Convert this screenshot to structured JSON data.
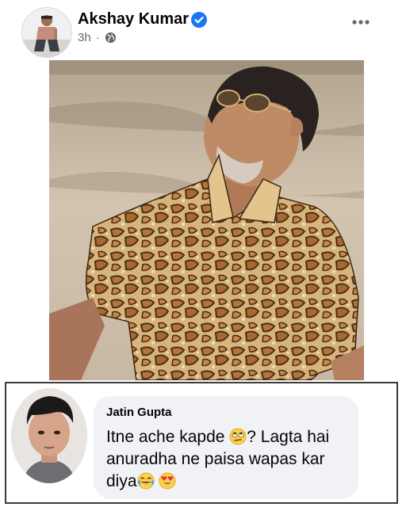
{
  "post": {
    "author": "Akshay Kumar",
    "time": "3h",
    "separator": "·",
    "privacy_icon": "globe-icon",
    "verified_icon": "verified-badge-icon",
    "more_icon": "more-options-icon"
  },
  "photo": {
    "shirt_pattern": "snakeskin",
    "colors": {
      "backdrop": "#c9b9a4",
      "shirt_base": "#c79a5c",
      "shirt_dark": "#5a3a1e"
    }
  },
  "comment": {
    "name": "Jatin Gupta",
    "text_part1": "Itne ache kapde",
    "text_part2": "? Lagta hai anuradha ne paisa wapas kar diya",
    "emojis": [
      "rolling-eyes-emoji",
      "tears-of-joy-emoji",
      "heart-eyes-emoji"
    ]
  },
  "colors": {
    "accent": "#1877f2",
    "muted": "#65676b",
    "bubble": "#f0f2f5"
  }
}
